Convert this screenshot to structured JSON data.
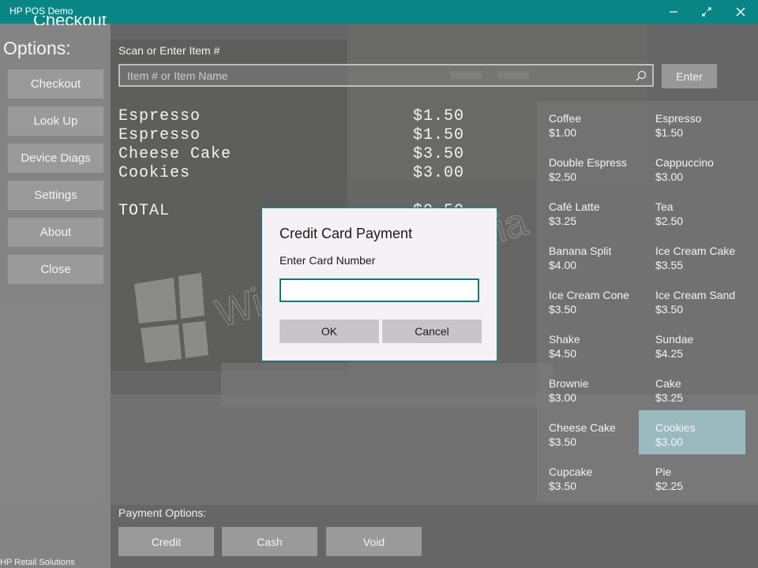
{
  "window": {
    "title": "HP POS Demo"
  },
  "sidebar": {
    "clipped_title": "Checkout",
    "options_label": "Options:",
    "items": [
      {
        "label": "Checkout"
      },
      {
        "label": "Look Up"
      },
      {
        "label": "Device Diags"
      },
      {
        "label": "Settings"
      },
      {
        "label": "About"
      },
      {
        "label": "Close"
      }
    ],
    "footer": "HP Retail Solutions"
  },
  "scan": {
    "label": "Scan or Enter Item #",
    "placeholder": "Item # or Item Name",
    "value": "",
    "enter_label": "Enter"
  },
  "receipt": {
    "lines": [
      {
        "name": "Espresso",
        "price": "$1.50"
      },
      {
        "name": "Espresso",
        "price": "$1.50"
      },
      {
        "name": "Cheese Cake",
        "price": "$3.50"
      },
      {
        "name": "Cookies",
        "price": "$3.00"
      }
    ],
    "total_label": "TOTAL",
    "total_value": "$9.50"
  },
  "menu": {
    "items": [
      {
        "name": "Coffee",
        "price": "$1.00"
      },
      {
        "name": "Espresso",
        "price": "$1.50"
      },
      {
        "name": "Double Espress",
        "price": "$2.50"
      },
      {
        "name": "Cappuccino",
        "price": "$3.00"
      },
      {
        "name": "Café Latte",
        "price": "$3.25"
      },
      {
        "name": "Tea",
        "price": "$2.50"
      },
      {
        "name": "Banana Split",
        "price": "$4.00"
      },
      {
        "name": "Ice Cream Cake",
        "price": "$3.55"
      },
      {
        "name": "Ice Cream Cone",
        "price": "$3.50"
      },
      {
        "name": "Ice Cream Sand",
        "price": "$3.50"
      },
      {
        "name": "Shake",
        "price": "$4.50"
      },
      {
        "name": "Sundae",
        "price": "$4.25"
      },
      {
        "name": "Brownie",
        "price": "$3.00"
      },
      {
        "name": "Cake",
        "price": "$3.25"
      },
      {
        "name": "Cheese Cake",
        "price": "$3.50"
      },
      {
        "name": "Cookies",
        "price": "$3.00"
      },
      {
        "name": "Cupcake",
        "price": "$3.50"
      },
      {
        "name": "Pie",
        "price": "$2.25"
      }
    ],
    "selected_index": 15
  },
  "payment": {
    "label": "Payment Options:",
    "buttons": [
      {
        "label": "Credit"
      },
      {
        "label": "Cash"
      },
      {
        "label": "Void"
      }
    ]
  },
  "dialog": {
    "title": "Credit Card Payment",
    "field_label": "Enter Card Number",
    "field_value": "",
    "ok_label": "OK",
    "cancel_label": "Cancel"
  },
  "watermark": "WindowsBlogItalia",
  "colors": {
    "title_bar": "#0a8585",
    "selected_item": "#8fb3b8",
    "dialog_border": "#0f8a8a"
  }
}
